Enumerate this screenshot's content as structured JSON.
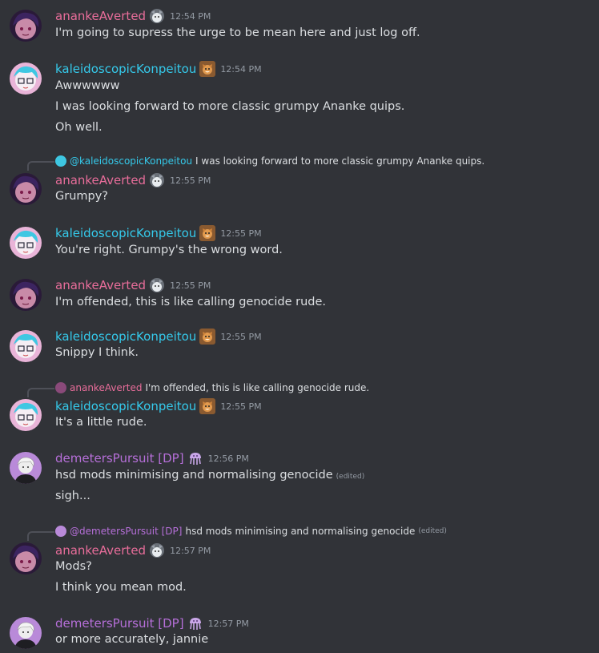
{
  "users": {
    "ananke": {
      "name": "anankeAverted",
      "color": "#e86d9a",
      "badge": "husky-badge-icon"
    },
    "kaleido": {
      "name": "kaleidoscopicKonpeitou",
      "color": "#35c9ea",
      "badge": "shiba-badge-icon"
    },
    "demeter": {
      "name": "demetersPursuit [DP]",
      "color": "#b66fd9",
      "badge": "jellyfish-badge-icon"
    }
  },
  "messages": [
    {
      "user": "anankeAverted",
      "time": "12:54 PM",
      "lines": [
        "I'm going to supress the urge to be mean here and just log off."
      ]
    },
    {
      "user": "kaleidoscopicKonpeitou",
      "time": "12:54 PM",
      "lines": [
        "Awwwwww",
        "I was looking forward to more classic grumpy Ananke quips.",
        "Oh well."
      ]
    },
    {
      "reply": {
        "name": "@kaleidoscopicKonpeitou",
        "text": "I was looking forward to more classic grumpy Ananke quips."
      },
      "user": "anankeAverted",
      "time": "12:55 PM",
      "lines": [
        "Grumpy?"
      ]
    },
    {
      "user": "kaleidoscopicKonpeitou",
      "time": "12:55 PM",
      "lines": [
        "You're right. Grumpy's the wrong word."
      ]
    },
    {
      "user": "anankeAverted",
      "time": "12:55 PM",
      "lines": [
        "I'm offended, this is like calling genocide rude."
      ]
    },
    {
      "user": "kaleidoscopicKonpeitou",
      "time": "12:55 PM",
      "lines": [
        "Snippy I think."
      ]
    },
    {
      "reply": {
        "name": "anankeAverted",
        "text": "I'm offended, this is like calling genocide rude."
      },
      "user": "kaleidoscopicKonpeitou",
      "time": "12:55 PM",
      "lines": [
        "It's a little rude."
      ]
    },
    {
      "user": "demetersPursuit [DP]",
      "time": "12:56 PM",
      "lines": [
        "hsd mods minimising and normalising genocide",
        "sigh..."
      ],
      "edited": "(edited)"
    },
    {
      "reply": {
        "name": "@demetersPursuit [DP]",
        "text": "hsd mods minimising and normalising genocide",
        "edited": "(edited)"
      },
      "user": "anankeAverted",
      "time": "12:57 PM",
      "lines": [
        "Mods?",
        "I think you mean mod."
      ]
    },
    {
      "user": "demetersPursuit [DP]",
      "time": "12:57 PM",
      "lines": [
        "or more accurately, jannie"
      ]
    }
  ]
}
